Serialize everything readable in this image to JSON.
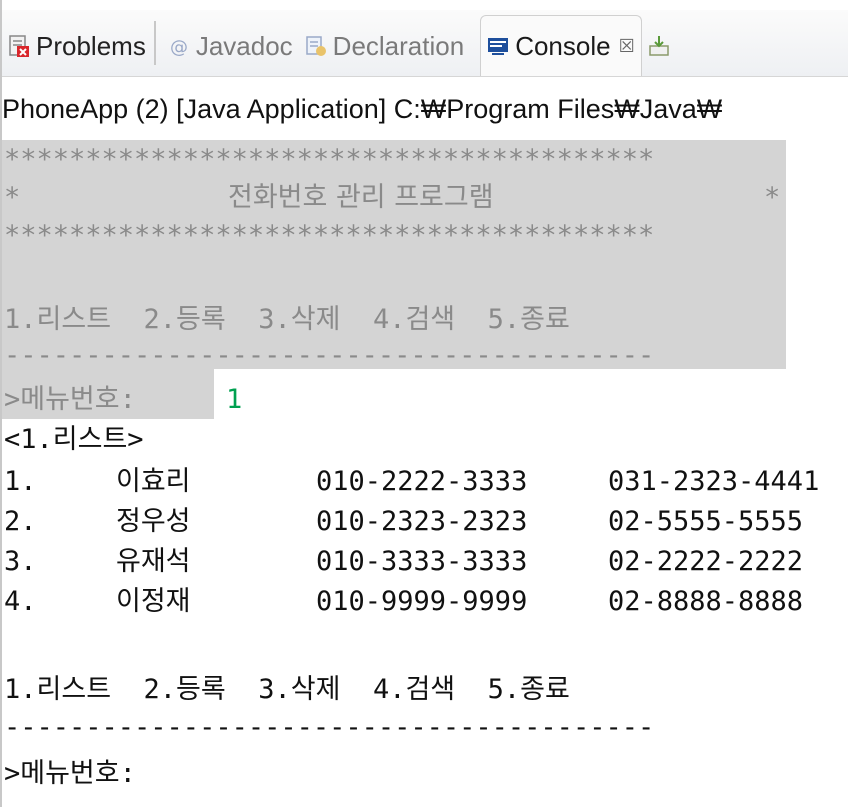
{
  "tabs": [
    {
      "name": "problems",
      "label": "Problems",
      "icon": "problems-icon",
      "active": false
    },
    {
      "name": "javadoc",
      "label": "Javadoc",
      "icon": "javadoc-icon",
      "active": false
    },
    {
      "name": "declaration",
      "label": "Declaration",
      "icon": "declaration-icon",
      "active": false
    },
    {
      "name": "console",
      "label": "Console",
      "icon": "console-icon",
      "active": true,
      "close": "☒"
    }
  ],
  "launch": "PhoneApp (2) [Java Application] C:₩Program Files₩Java₩",
  "console": {
    "stars": "****************************************",
    "title_left": "*",
    "title": "전화번호 관리 프로그램",
    "title_right": "*",
    "menu": "1.리스트  2.등록  3.삭제  4.검색  5.종료",
    "dashes": "----------------------------------------",
    "prompt": ">메뉴번호:",
    "input": "1",
    "list_header": "<1.리스트>",
    "rows": [
      {
        "no": "1.",
        "name": "이효리",
        "hp": "010-2222-3333",
        "company": "031-2323-4441"
      },
      {
        "no": "2.",
        "name": "정우성",
        "hp": "010-2323-2323",
        "company": "02-5555-5555"
      },
      {
        "no": "3.",
        "name": "유재석",
        "hp": "010-3333-3333",
        "company": "02-2222-2222"
      },
      {
        "no": "4.",
        "name": "이정재",
        "hp": "010-9999-9999",
        "company": "02-8888-8888"
      }
    ],
    "menu2": "1.리스트  2.등록  3.삭제  4.검색  5.종료",
    "dashes2": "----------------------------------------",
    "prompt2": ">메뉴번호:"
  }
}
